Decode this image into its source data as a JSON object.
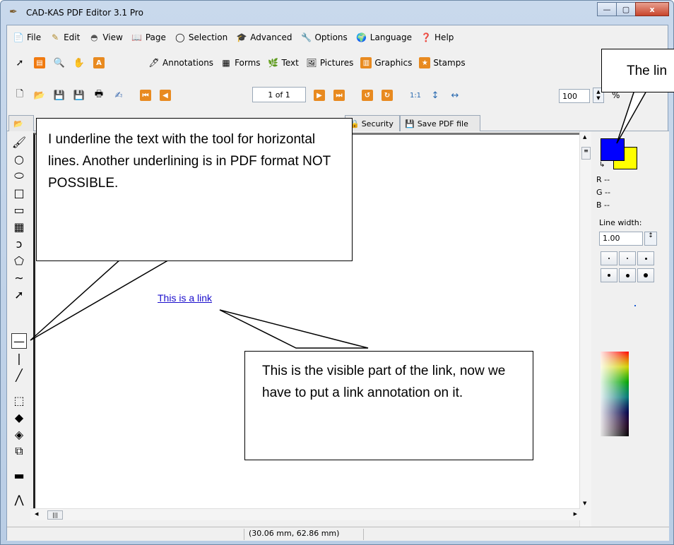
{
  "window": {
    "title": "CAD-KAS PDF Editor 3.1 Pro",
    "minimize": "—",
    "maximize": "▢",
    "close": "x"
  },
  "menu": [
    "File",
    "Edit",
    "View",
    "Page",
    "Selection",
    "Advanced",
    "Options",
    "Language",
    "Help"
  ],
  "toolbar2": {
    "labels": [
      "Annotations",
      "Forms",
      "Text",
      "Pictures",
      "Graphics",
      "Stamps"
    ]
  },
  "toolbar3": {
    "page_indicator": "1 of 1",
    "zoom_value": "100",
    "zoom_unit": "%"
  },
  "tabs": {
    "security": "Security",
    "save": "Save PDF file"
  },
  "document": {
    "link_text": "This is a link"
  },
  "right_panel": {
    "r": "R --",
    "g": "G --",
    "b": "B --",
    "line_width_label": "Line width:",
    "line_width_value": "1.00",
    "fg_color": "#0000ff",
    "bg_color": "#ffff00"
  },
  "status": {
    "coords": "(30.06 mm, 62.86 mm)"
  },
  "callouts": {
    "left": "I underline the text with the tool for horizontal lines. Another underlining is in PDF format NOT POSSIBLE.",
    "bottom": "This is the visible part of the link, now we have to put a link annotation on it.",
    "top_right": "The lin"
  }
}
